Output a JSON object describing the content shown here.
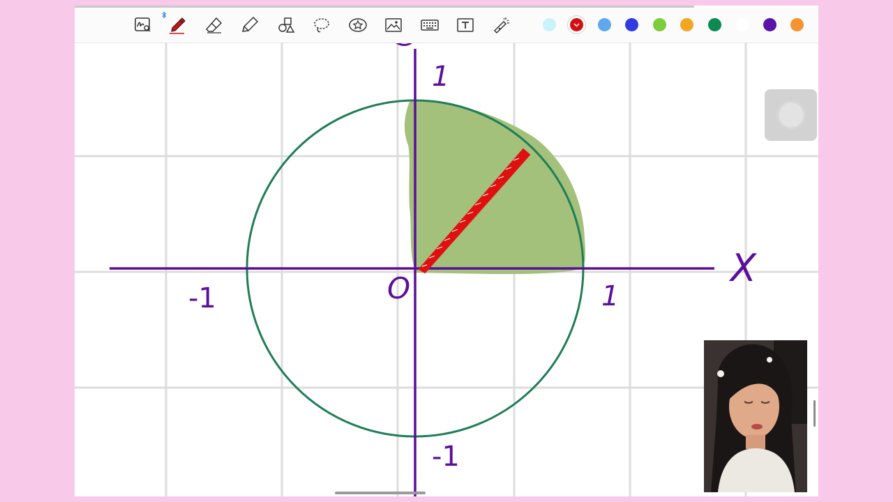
{
  "toolbar": {
    "tools": [
      {
        "name": "handwriting-search-tool-icon",
        "selected": false
      },
      {
        "name": "pen-tool-icon",
        "selected": true,
        "bluetooth": true
      },
      {
        "name": "eraser-tool-icon",
        "selected": false
      },
      {
        "name": "highlighter-tool-icon",
        "selected": false
      },
      {
        "name": "shapes-tool-icon",
        "selected": false
      },
      {
        "name": "lasso-tool-icon",
        "selected": false
      },
      {
        "name": "sticker-tool-icon",
        "selected": false
      },
      {
        "name": "image-tool-icon",
        "selected": false
      },
      {
        "name": "keyboard-tool-icon",
        "selected": false
      },
      {
        "name": "text-tool-icon",
        "selected": false
      },
      {
        "name": "laser-pointer-tool-icon",
        "selected": false
      }
    ],
    "colors": [
      {
        "name": "light-cyan",
        "hex": "#c9f3fb",
        "selected": false
      },
      {
        "name": "red",
        "hex": "#d40f14",
        "selected": true
      },
      {
        "name": "sky-blue",
        "hex": "#5fa8ee",
        "selected": false
      },
      {
        "name": "blue",
        "hex": "#2f3be0",
        "selected": false
      },
      {
        "name": "green",
        "hex": "#7ccd3c",
        "selected": false
      },
      {
        "name": "orange",
        "hex": "#f4a623",
        "selected": false
      },
      {
        "name": "dark-green",
        "hex": "#0c8a52",
        "selected": false
      },
      {
        "name": "white",
        "hex": "#ffffff",
        "selected": false
      },
      {
        "name": "purple",
        "hex": "#5b14a8",
        "selected": false
      },
      {
        "name": "light-orange",
        "hex": "#f5932f",
        "selected": false
      }
    ]
  },
  "drawing": {
    "labels": {
      "y_top": "1",
      "y_bottom": "-1",
      "x_left": "-1",
      "x_right": "1",
      "origin": "O",
      "x_axis": "X"
    },
    "colors": {
      "axis": "#5b0f9a",
      "circle": "#1f7d57",
      "shaded_region": "#a3c17a",
      "radius_line": "#e01010",
      "grid": "#dcdcdc"
    }
  }
}
